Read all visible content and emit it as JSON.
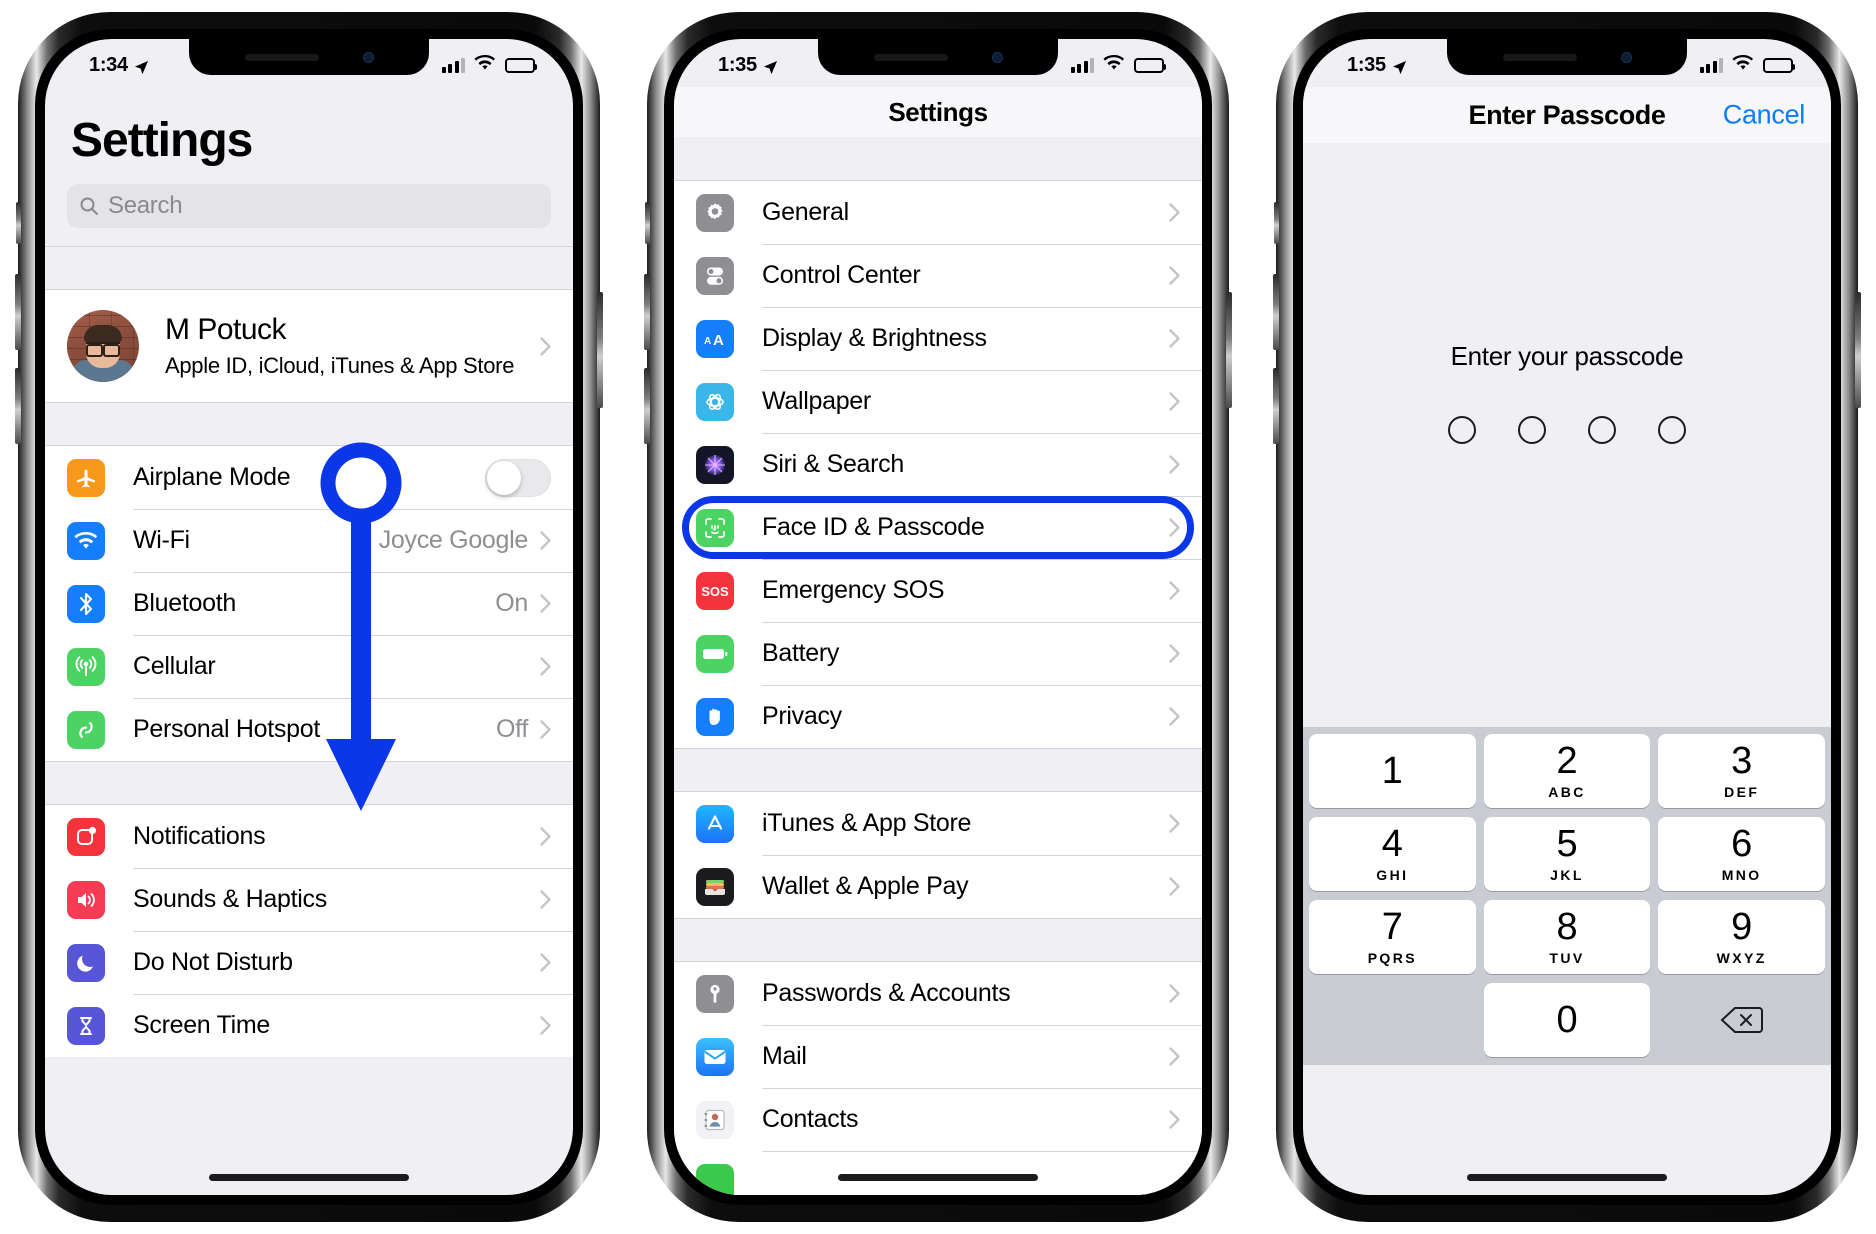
{
  "phone1": {
    "status": {
      "time": "1:34",
      "location_icon": "location-arrow-icon",
      "signal_icon": "cellular-signal-icon",
      "wifi_icon": "wifi-icon",
      "battery_icon": "battery-icon"
    },
    "title": "Settings",
    "search": {
      "placeholder": "Search",
      "icon": "search-icon"
    },
    "profile": {
      "name": "M Potuck",
      "subtitle": "Apple ID, iCloud, iTunes & App Store",
      "avatar": "user-avatar"
    },
    "groups": [
      {
        "rows": [
          {
            "label": "Airplane Mode",
            "icon": "airplane-icon",
            "color": "#f8981d",
            "control": "toggle",
            "toggle_on": false
          },
          {
            "label": "Wi-Fi",
            "icon": "wifi-icon",
            "color": "#147efb",
            "value": "Joyce Google",
            "control": "chevron"
          },
          {
            "label": "Bluetooth",
            "icon": "bluetooth-icon",
            "color": "#147efb",
            "value": "On",
            "control": "chevron"
          },
          {
            "label": "Cellular",
            "icon": "cellular-icon",
            "color": "#4cd364",
            "value": "",
            "control": "chevron"
          },
          {
            "label": "Personal Hotspot",
            "icon": "hotspot-icon",
            "color": "#4cd364",
            "value": "Off",
            "control": "chevron"
          }
        ]
      },
      {
        "rows": [
          {
            "label": "Notifications",
            "icon": "notifications-icon",
            "color": "#f4333d",
            "value": "",
            "control": "chevron"
          },
          {
            "label": "Sounds & Haptics",
            "icon": "sounds-icon",
            "color": "#f63b54",
            "value": "",
            "control": "chevron"
          },
          {
            "label": "Do Not Disturb",
            "icon": "moon-icon",
            "color": "#5756d6",
            "value": "",
            "control": "chevron"
          },
          {
            "label": "Screen Time",
            "icon": "hourglass-icon",
            "color": "#5756d6",
            "value": "",
            "control": "chevron"
          }
        ]
      }
    ],
    "annotation": {
      "type": "arrow-down-callout",
      "color": "#0b37e8"
    }
  },
  "phone2": {
    "status": {
      "time": "1:35"
    },
    "navbar_title": "Settings",
    "groups": [
      {
        "rows": [
          {
            "label": "General",
            "icon": "gear-icon",
            "color": "#8e8e93"
          },
          {
            "label": "Control Center",
            "icon": "control-center-icon",
            "color": "#8e8e93"
          },
          {
            "label": "Display & Brightness",
            "icon": "display-brightness-icon",
            "color": "#147efb"
          },
          {
            "label": "Wallpaper",
            "icon": "wallpaper-icon",
            "color": "#3ab6e8"
          },
          {
            "label": "Siri & Search",
            "icon": "siri-icon",
            "color": "#1c1c2e"
          },
          {
            "label": "Face ID & Passcode",
            "icon": "face-id-icon",
            "color": "#4cd364",
            "highlighted": true
          },
          {
            "label": "Emergency SOS",
            "icon": "sos-icon",
            "color": "#f4333d"
          },
          {
            "label": "Battery",
            "icon": "battery-icon",
            "color": "#4cd364"
          },
          {
            "label": "Privacy",
            "icon": "privacy-hand-icon",
            "color": "#147efb"
          }
        ]
      },
      {
        "rows": [
          {
            "label": "iTunes & App Store",
            "icon": "app-store-icon",
            "color": "#1d9bf6"
          },
          {
            "label": "Wallet & Apple Pay",
            "icon": "wallet-icon",
            "color": "#1c1c1e"
          }
        ]
      },
      {
        "rows": [
          {
            "label": "Passwords & Accounts",
            "icon": "key-icon",
            "color": "#8e8e93"
          },
          {
            "label": "Mail",
            "icon": "mail-icon",
            "color": "#1d9bf6"
          },
          {
            "label": "Contacts",
            "icon": "contacts-icon",
            "color": "#8e8e93"
          }
        ]
      }
    ],
    "highlight_color": "#0b37e8"
  },
  "phone3": {
    "status": {
      "time": "1:35"
    },
    "navbar_title": "Enter Passcode",
    "cancel_label": "Cancel",
    "prompt": "Enter your passcode",
    "dots": 4,
    "keypad": [
      [
        {
          "digit": "1",
          "letters": ""
        },
        {
          "digit": "2",
          "letters": "ABC"
        },
        {
          "digit": "3",
          "letters": "DEF"
        }
      ],
      [
        {
          "digit": "4",
          "letters": "GHI"
        },
        {
          "digit": "5",
          "letters": "JKL"
        },
        {
          "digit": "6",
          "letters": "MNO"
        }
      ],
      [
        {
          "digit": "7",
          "letters": "PQRS"
        },
        {
          "digit": "8",
          "letters": "TUV"
        },
        {
          "digit": "9",
          "letters": "WXYZ"
        }
      ],
      [
        {
          "digit": "",
          "letters": "",
          "blank": true
        },
        {
          "digit": "0",
          "letters": ""
        },
        {
          "digit": "",
          "letters": "",
          "icon": "delete-backward-icon"
        }
      ]
    ]
  }
}
